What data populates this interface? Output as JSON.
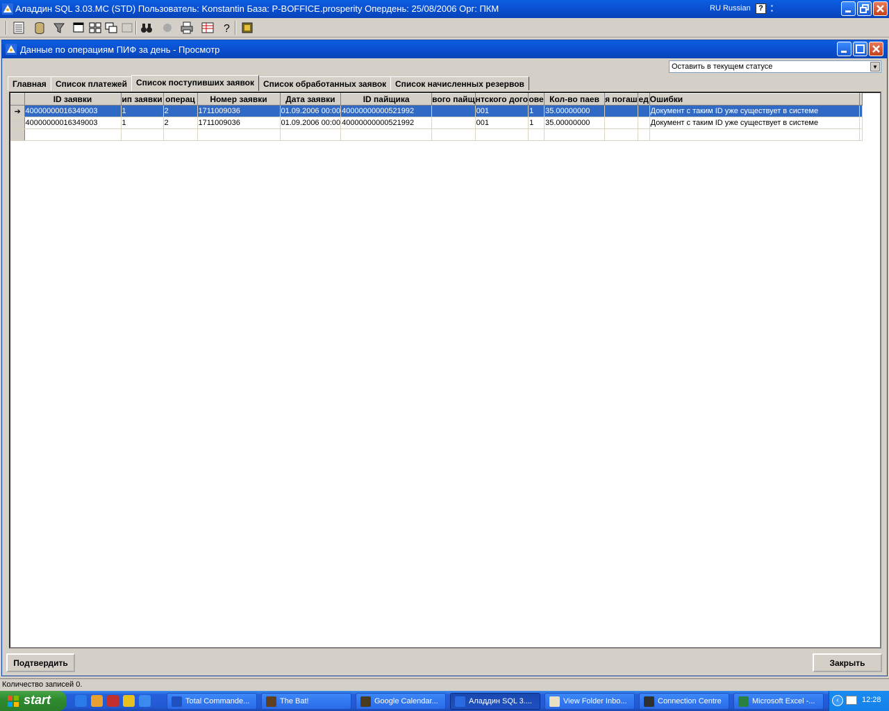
{
  "app": {
    "title": "Аладдин SQL 3.03.MC (STD)  Пользователь: Konstantin База: P-BOFFICE.prosperity Опердень: 25/08/2006 Орг: ПКМ",
    "language": "RU Russian",
    "help_label": "?"
  },
  "window": {
    "title": "Данные по операциям ПИФ за день - Просмотр",
    "status_select_value": "Оставить в текущем статусе"
  },
  "tabs": [
    {
      "label": "Главная",
      "active": false
    },
    {
      "label": "Список платежей",
      "active": false
    },
    {
      "label": "Список поступивших заявок",
      "active": true
    },
    {
      "label": "Список обработанных заявок",
      "active": false
    },
    {
      "label": "Список начисленных резервов",
      "active": false
    }
  ],
  "grid": {
    "columns": [
      "ID заявки",
      "ип заявки",
      "операц",
      "Номер заявки",
      "Дата заявки",
      "ID пайщика",
      "вого пайщ",
      "нтского дого",
      "ове",
      "Кол-во паев",
      "я погаш",
      "ед",
      "Ошибки"
    ],
    "rows": [
      {
        "selected": true,
        "indicator": "➔",
        "cells": [
          "40000000016349003",
          "1",
          "2",
          "1711009036",
          "01.09.2006 00:00",
          "40000000000521992",
          "",
          "001",
          "1",
          "35.00000000",
          "",
          "",
          "Документ с таким ID уже существует в системе"
        ]
      },
      {
        "selected": false,
        "indicator": "",
        "cells": [
          "40000000016349003",
          "1",
          "2",
          "1711009036",
          "01.09.2006 00:00",
          "40000000000521992",
          "",
          "001",
          "1",
          "35.00000000",
          "",
          "",
          "Документ с таким ID уже существует в системе"
        ]
      },
      {
        "selected": false,
        "indicator": "",
        "cells": [
          "",
          "",
          "",
          "",
          "",
          "",
          "",
          "",
          "",
          "",
          "",
          "",
          ""
        ]
      }
    ]
  },
  "buttons": {
    "confirm": "Подтвердить",
    "close": "Закрыть"
  },
  "statusbar": {
    "text": "Количество записей 0."
  },
  "taskbar": {
    "start": "start",
    "tasks": [
      {
        "label": "Total Commande...",
        "active": false
      },
      {
        "label": "The Bat!",
        "active": false
      },
      {
        "label": "Google Calendar...",
        "active": false
      },
      {
        "label": "Аладдин SQL 3....",
        "active": true
      },
      {
        "label": "View Folder Inbo...",
        "active": false
      },
      {
        "label": "Connection Centre",
        "active": false
      },
      {
        "label": "Microsoft Excel -...",
        "active": false
      }
    ],
    "clock": "12:28"
  },
  "colors": {
    "titlebar": "#0a4fd0",
    "selection": "#316ac5",
    "face": "#d4d0c8",
    "taskbar": "#245ed8",
    "start": "#2f8c2f"
  },
  "icons": {
    "toolbar": [
      "list-icon",
      "database-icon",
      "filter-icon",
      "window-icon",
      "tile-icon",
      "cascade-icon",
      "restore-icon",
      "binoculars-icon",
      "stop-icon",
      "print-icon",
      "export-icon",
      "help-icon",
      "calculator-icon"
    ]
  }
}
